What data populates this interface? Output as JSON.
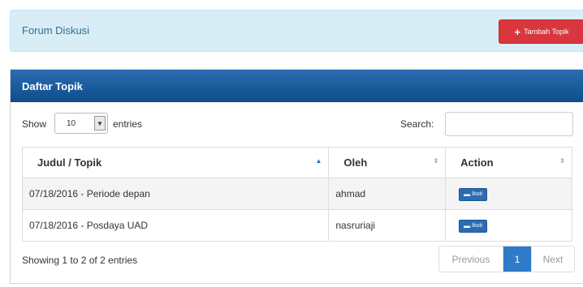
{
  "header": {
    "title": "Forum Diskusi",
    "add_button_label": "Tambah Topik"
  },
  "panel": {
    "title": "Daftar Topik"
  },
  "controls": {
    "show_label": "Show",
    "entries_value": "10",
    "entries_label": "entries",
    "search_label": "Search:",
    "search_value": ""
  },
  "table": {
    "columns": [
      "Judul / Topik",
      "Oleh",
      "Action"
    ],
    "rows": [
      {
        "judul": "07/18/2016 - Periode depan",
        "oleh": "ahmad",
        "action": "Ikuti"
      },
      {
        "judul": "07/18/2016 - Posdaya UAD",
        "oleh": "nasruriaji",
        "action": "Ikuti"
      }
    ]
  },
  "footer": {
    "info": "Showing 1 to 2 of 2 entries",
    "previous": "Previous",
    "current_page": "1",
    "next": "Next"
  },
  "icons": {
    "add": "plus-icon",
    "reply": "comment-icon",
    "select": "chevron-down-icon",
    "sort": "sort-icon"
  },
  "colors": {
    "add_button": "#d9363e",
    "panel_heading": "#0f4c8a",
    "header_bg": "#d9edf7",
    "action_button": "#2a6db0",
    "active_page": "#2f7bc9"
  }
}
